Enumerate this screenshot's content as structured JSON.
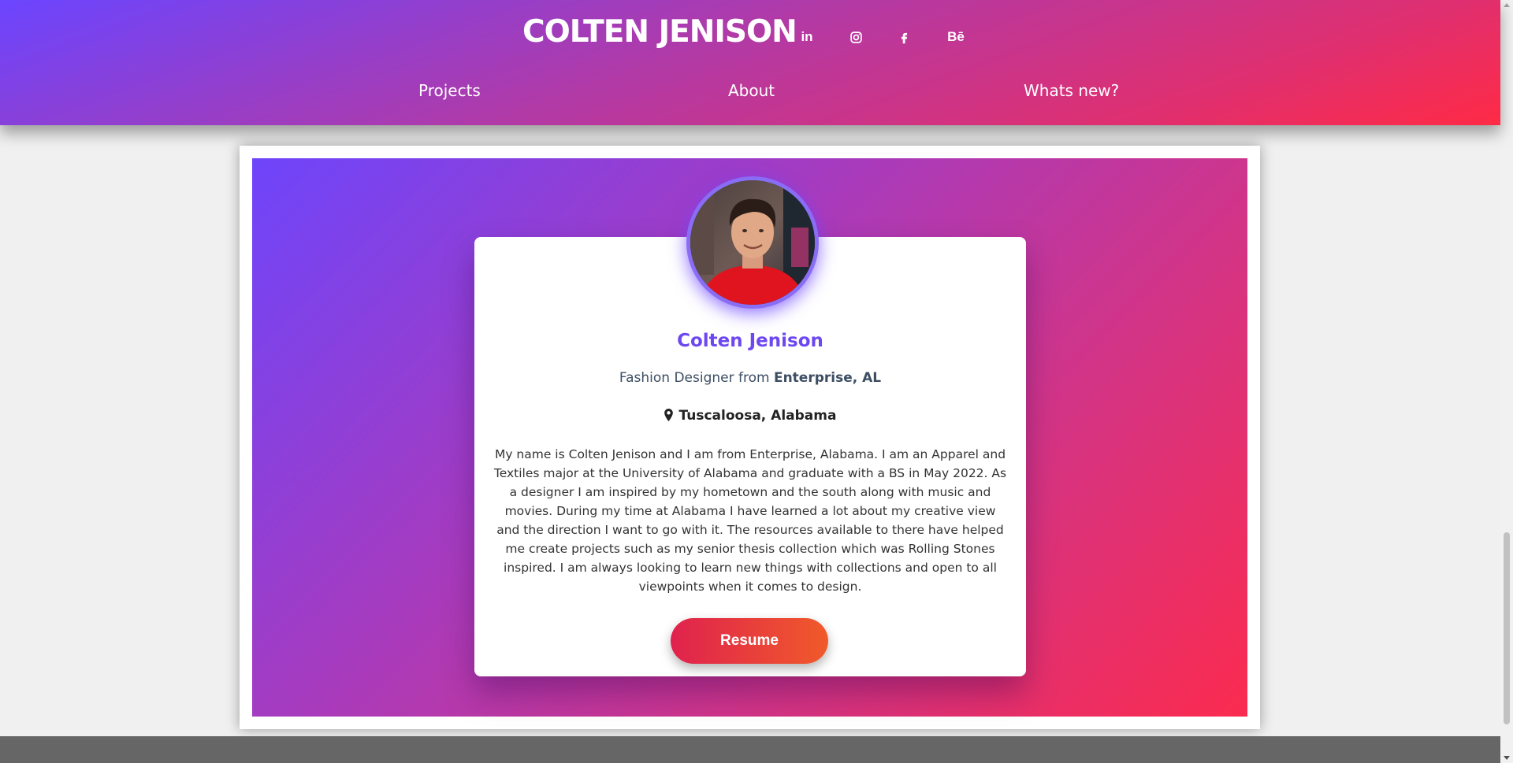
{
  "header": {
    "brand": "COLTEN JENISON",
    "social": [
      {
        "name": "linkedin",
        "label": "in"
      },
      {
        "name": "instagram",
        "label": ""
      },
      {
        "name": "facebook",
        "label": ""
      },
      {
        "name": "behance",
        "label": "Bē"
      }
    ],
    "nav": [
      "Projects",
      "About",
      "Whats new?"
    ]
  },
  "profile": {
    "name": "Colten Jenison",
    "subtitle_prefix": "Fashion Designer from ",
    "subtitle_place": "Enterprise, AL",
    "location": "Tuscaloosa, Alabama",
    "bio": "My name is Colten Jenison and I am from Enterprise, Alabama. I am an Apparel and Textiles major at the University of Alabama and graduate with a BS in May 2022. As a designer I am inspired by my hometown and the south along with music and movies. During my time at Alabama I have learned a lot about my creative view and the direction I want to go with it. The resources available to there have helped me create projects such as my senior thesis collection which was Rolling Stones inspired. I am always looking to learn new things with collections and open to all viewpoints when it comes to design.",
    "resume_label": "Resume"
  },
  "colors": {
    "gradient_start": "#6b45ff",
    "gradient_end": "#ff2a45",
    "name_color": "#6d47f0",
    "button_start": "#e0224e",
    "button_end": "#f05a2a"
  }
}
